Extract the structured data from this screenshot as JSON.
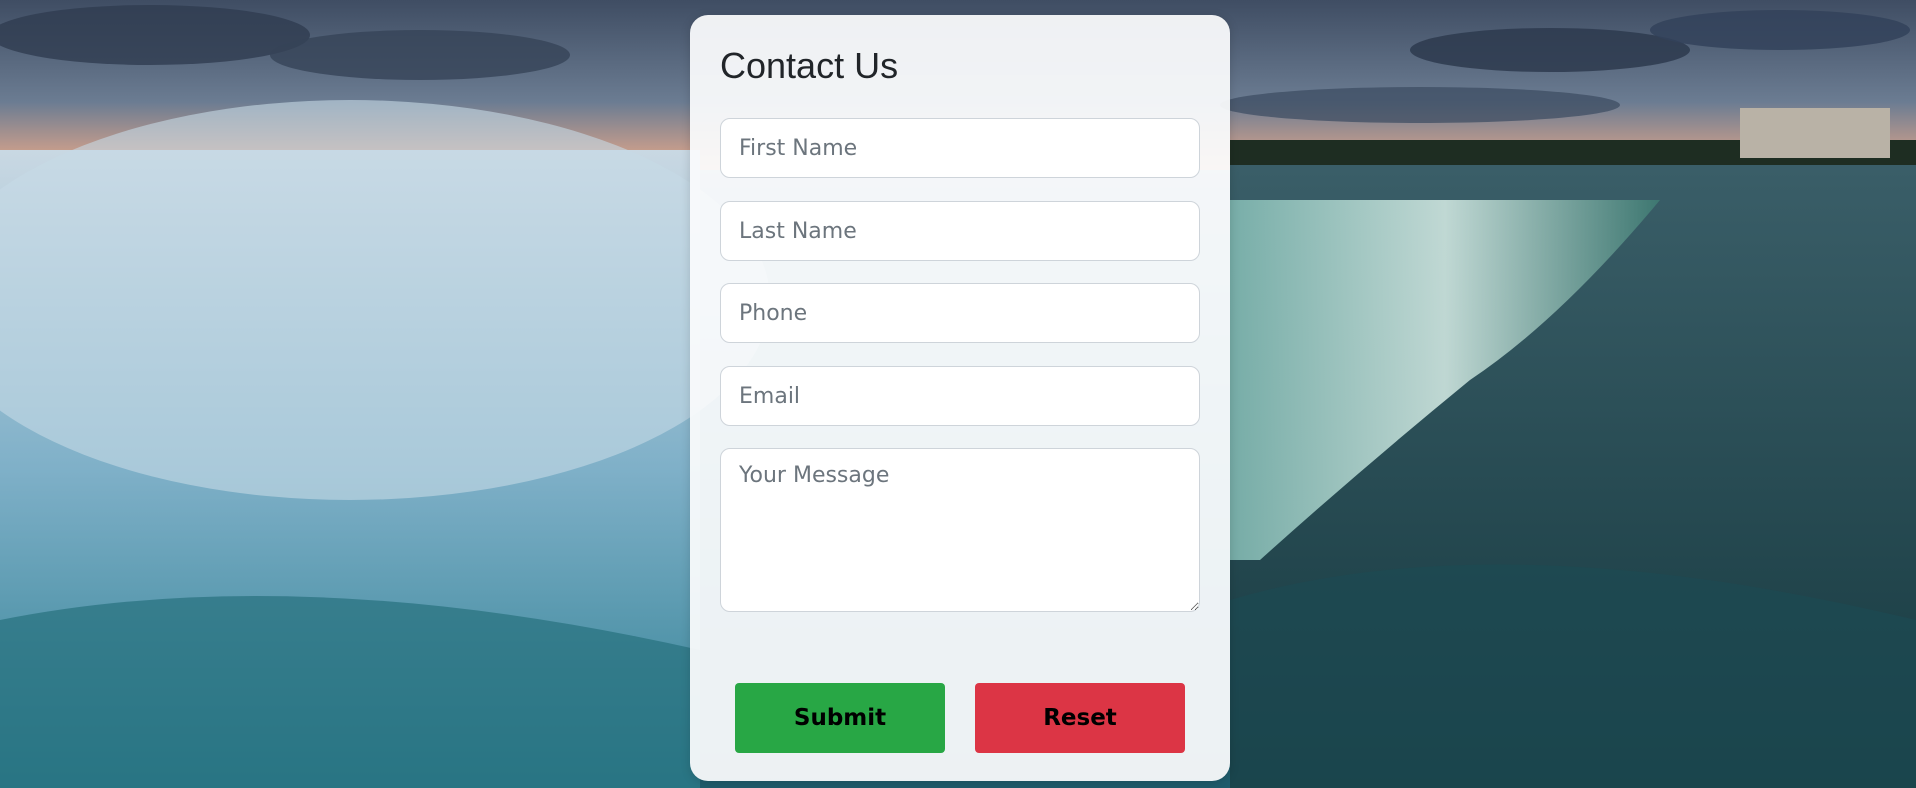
{
  "form": {
    "title": "Contact Us",
    "fields": {
      "first_name": {
        "placeholder": "First Name",
        "value": ""
      },
      "last_name": {
        "placeholder": "Last Name",
        "value": ""
      },
      "phone": {
        "placeholder": "Phone",
        "value": ""
      },
      "email": {
        "placeholder": "Email",
        "value": ""
      },
      "message": {
        "placeholder": "Your Message",
        "value": ""
      }
    },
    "buttons": {
      "submit_label": "Submit",
      "reset_label": "Reset"
    }
  },
  "colors": {
    "submit_bg": "#28a745",
    "reset_bg": "#dc3545",
    "card_bg": "#fafbfc",
    "placeholder": "#6c757d"
  },
  "background": {
    "icon": "waterfall-photo"
  }
}
